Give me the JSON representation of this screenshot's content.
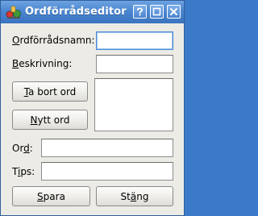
{
  "window": {
    "title": "Ordförrådseditor",
    "icon": "app-icon",
    "controls": [
      {
        "name": "help-icon",
        "glyph": "?"
      },
      {
        "name": "maximize-icon",
        "glyph": "□"
      },
      {
        "name": "close-icon",
        "glyph": "✕"
      }
    ]
  },
  "form": {
    "ordforradsnamn_label": {
      "mnemonic": "O",
      "rest": "rdförrådsnamn:"
    },
    "ordforradsnamn_value": "",
    "beskrivning_label": {
      "mnemonic": "B",
      "rest": "eskrivning:"
    },
    "beskrivning_value": "",
    "ta_bort_ord_button": {
      "mnemonic": "T",
      "rest": "a bort ord"
    },
    "nytt_ord_button": {
      "pre": "",
      "mnemonic": "N",
      "rest": "ytt ord"
    },
    "word_list_items": [],
    "ord_label": {
      "pre": "Or",
      "mnemonic": "d",
      "rest": ":"
    },
    "ord_value": "",
    "tips_label": {
      "pre": "T",
      "mnemonic": "i",
      "rest": "ps:"
    },
    "tips_value": ""
  },
  "footer": {
    "spara_button": {
      "mnemonic": "S",
      "rest": "para"
    },
    "stang_button": {
      "pre": "St",
      "mnemonic": "ä",
      "rest": "ng"
    }
  },
  "colors": {
    "titlebar": "#4b86d0",
    "window_bg": "#ecebe6",
    "focus_border": "#4a8bd6"
  }
}
